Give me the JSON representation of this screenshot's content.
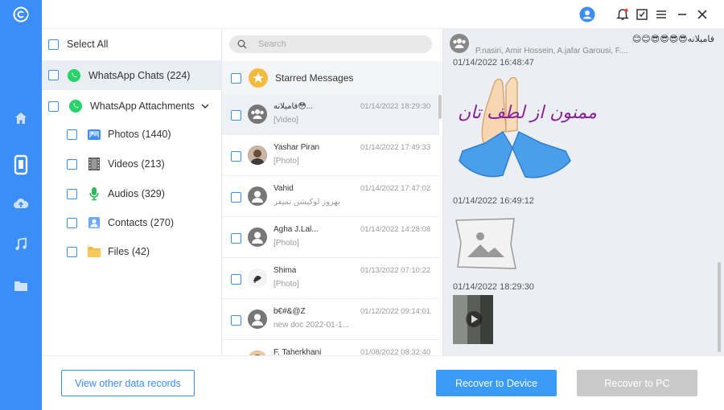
{
  "toolbar": {
    "icons": [
      "user-icon",
      "bell-icon",
      "feedback-icon",
      "menu-icon",
      "minimize-icon",
      "close-icon"
    ]
  },
  "categories": {
    "select_all": "Select All",
    "whatsapp_chats": "WhatsApp Chats (224)",
    "whatsapp_attachments": "WhatsApp Attachments",
    "photos": "Photos (1440)",
    "videos": "Videos (213)",
    "audios": "Audios (329)",
    "contacts": "Contacts (270)",
    "files": "Files (42)"
  },
  "chat_list": {
    "search_placeholder": "Search",
    "starred": "Starred Messages",
    "items": [
      {
        "name": "فامیلانه😳...",
        "preview": "[Video]",
        "time": "01/14/2022 18:29:30"
      },
      {
        "name": "Yashar Piran",
        "preview": "[Photo]",
        "time": "01/14/2022 17:49:33"
      },
      {
        "name": "Vahid",
        "preview": "بهروز لوکیشن تمیفر",
        "time": "01/14/2022 17:47:02"
      },
      {
        "name": "Agha J.Lal...",
        "preview": "[Photo]",
        "time": "01/14/2022 14:28:08"
      },
      {
        "name": "Shima",
        "preview": "[Photo]",
        "time": "01/13/2022 07:10:22"
      },
      {
        "name": "b€#&@Z",
        "preview": "new doc 2022-01-1...",
        "time": "01/12/2022 09:14:01"
      },
      {
        "name": "F. Taherkhani",
        "preview": "",
        "time": "01/08/2022 08:32:40"
      }
    ]
  },
  "chat_view": {
    "group_name": "😊😊😎😎😎😎فامیلانه",
    "members": "P.nasiri, Amir Hossein, A.jafar Garousi, F....",
    "timestamps": [
      "01/14/2022 16:48:47",
      "01/14/2022 16:49:12",
      "01/14/2022 18:29:30"
    ],
    "sticker_text": "ممنون از لطف تان"
  },
  "actions": {
    "view_other": "View other data records",
    "recover_device": "Recover to Device",
    "recover_pc": "Recover to PC"
  },
  "colors": {
    "accent": "#3a8ef6",
    "whatsapp": "#25d366"
  }
}
